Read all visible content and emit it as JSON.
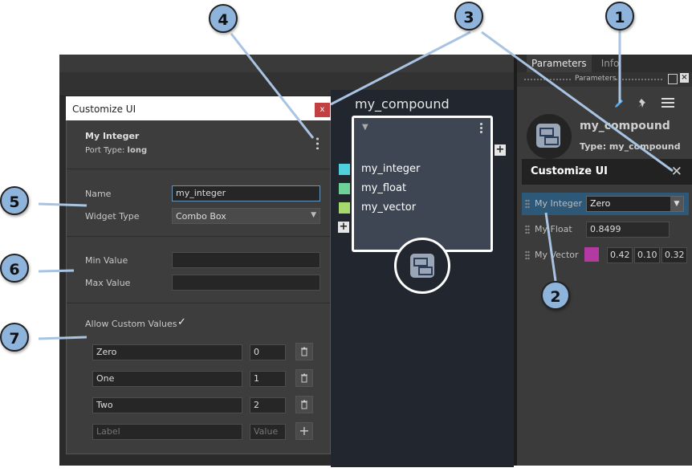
{
  "right_panel": {
    "tabs": [
      "Parameters",
      "Info"
    ],
    "sub_title": "Parameters",
    "node_name": "my_compound",
    "node_type": "Type: my_compound",
    "customize_title": "Customize UI",
    "params": [
      {
        "label": "My Integer",
        "value": "Zero"
      },
      {
        "label": "My Float",
        "value": "0.8499"
      },
      {
        "label": "My Vector",
        "v1": "0.42",
        "v2": "0.10",
        "v3": "0.32"
      }
    ]
  },
  "dialog": {
    "title": "Customize UI",
    "close_label": "x",
    "port_name": "My Integer",
    "port_type_label": "Port Type:",
    "port_type_value": "long",
    "name_label": "Name",
    "name_value": "my_integer",
    "widget_type_label": "Widget Type",
    "widget_type_value": "Combo Box",
    "min_label": "Min Value",
    "max_label": "Max Value",
    "allow_custom_label": "Allow Custom Values",
    "items": [
      {
        "label": "Zero",
        "value": "0"
      },
      {
        "label": "One",
        "value": "1"
      },
      {
        "label": "Two",
        "value": "2"
      }
    ],
    "label_placeholder": "Label",
    "value_placeholder": "Value"
  },
  "graph": {
    "compound_title": "my_compound",
    "ports": [
      {
        "name": "my_integer",
        "color": "#4fd0dc"
      },
      {
        "name": "my_float",
        "color": "#6fd19a"
      },
      {
        "name": "my_vector",
        "color": "#a7d86e"
      }
    ]
  },
  "callouts": [
    "1",
    "2",
    "3",
    "4",
    "5",
    "6",
    "7"
  ],
  "colors": {
    "vector_swatch": "#b23aa0",
    "close_button": "#c24040",
    "callout": "#8fb4dc"
  }
}
